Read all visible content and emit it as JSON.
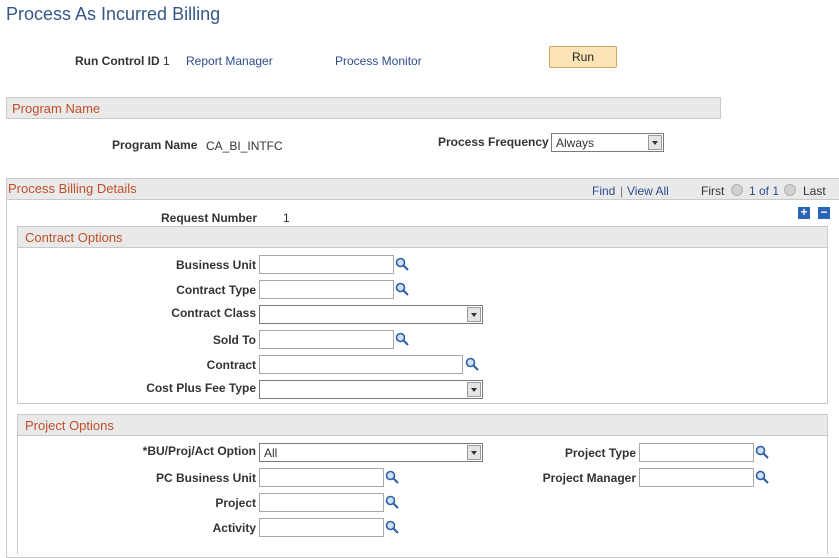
{
  "page": {
    "title": "Process As Incurred Billing"
  },
  "header": {
    "run_control_label": "Run Control ID",
    "run_control_value": "1",
    "report_manager": "Report Manager",
    "process_monitor": "Process Monitor",
    "run_button": "Run"
  },
  "program": {
    "section_title": "Program Name",
    "name_label": "Program Name",
    "name_value": "CA_BI_INTFC",
    "frequency_label": "Process Frequency",
    "frequency_value": "Always"
  },
  "details": {
    "section_title": "Process Billing Details",
    "find": "Find",
    "separator": "|",
    "view_all": "View All",
    "first": "First",
    "pagination": "1 of 1",
    "last": "Last",
    "request_label": "Request Number",
    "request_value": "1",
    "add": "+",
    "remove": "−"
  },
  "contract_options": {
    "title": "Contract Options",
    "business_unit": "Business Unit",
    "contract_type": "Contract Type",
    "contract_class": "Contract Class",
    "sold_to": "Sold To",
    "contract": "Contract",
    "cost_plus_fee_type": "Cost Plus Fee Type",
    "contract_class_value": "",
    "cost_plus_fee_type_value": ""
  },
  "project_options": {
    "title": "Project Options",
    "bu_proj_act_label": "*BU/Proj/Act Option",
    "bu_proj_act_value": "All",
    "pc_business_unit": "PC Business Unit",
    "project": "Project",
    "activity": "Activity",
    "project_type": "Project Type",
    "project_manager": "Project Manager"
  },
  "icons": {
    "lookup": "magnifier-icon",
    "first_arrow": "arrow-left-icon",
    "last_arrow": "arrow-right-icon"
  }
}
